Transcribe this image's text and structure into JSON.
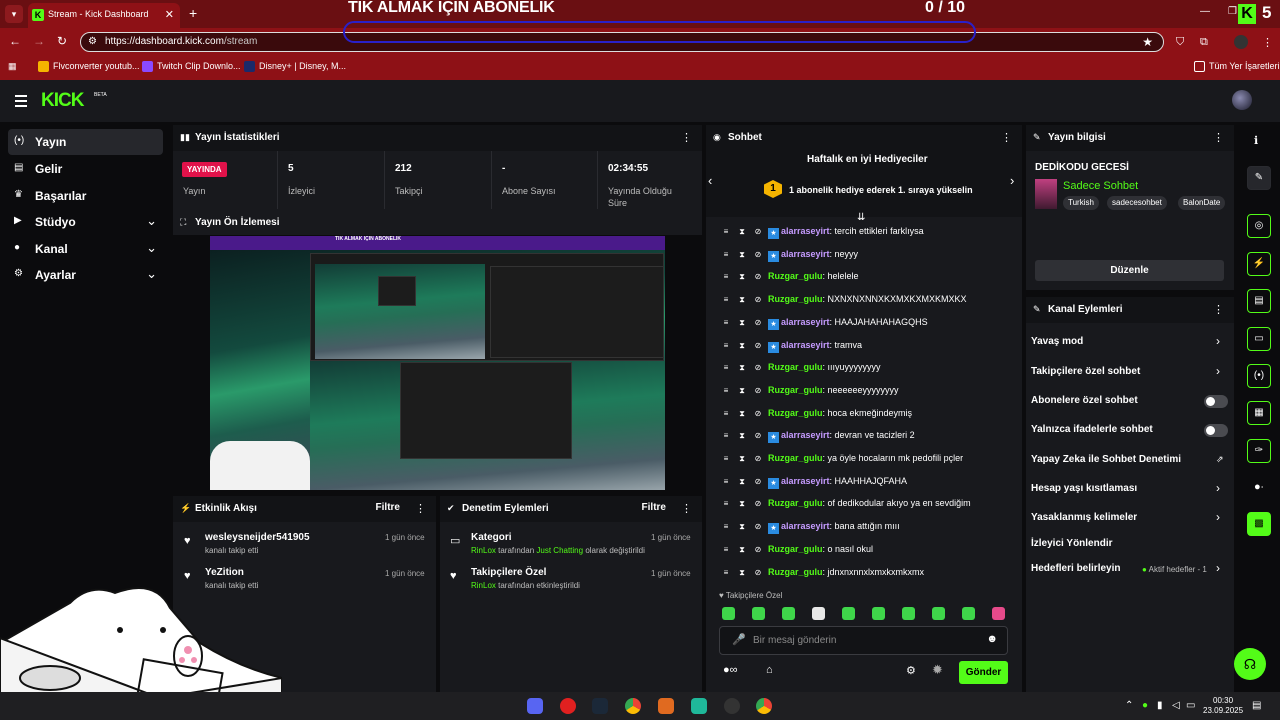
{
  "browser": {
    "tab_title": "Stream - Kick Dashboard",
    "tab_close": "✕",
    "new_tab": "+",
    "url_prefix": "https://",
    "url_host": "dashboard.kick.com",
    "url_path": "/stream",
    "bookmarks": [
      "Flvconverter youtub...",
      "Twitch Clip Downlo...",
      "Disney+ | Disney, M..."
    ],
    "all_bookmarks": "Tüm Yer İşaretleri"
  },
  "stream_overlay": {
    "title": "TIK ALMAK IÇIN ABONELIK",
    "count": "0  / 10",
    "corner_count": "5"
  },
  "app": {
    "logo": "KICK",
    "beta": "BETA"
  },
  "sidebar": {
    "items": [
      {
        "label": "Yayın",
        "icon": "broadcast-icon",
        "active": true
      },
      {
        "label": "Gelir",
        "icon": "wallet-icon"
      },
      {
        "label": "Başarılar",
        "icon": "trophy-icon"
      },
      {
        "label": "Stüdyo",
        "icon": "video-icon",
        "expandable": true
      },
      {
        "label": "Kanal",
        "icon": "user-icon",
        "expandable": true
      },
      {
        "label": "Ayarlar",
        "icon": "gear-icon",
        "expandable": true
      }
    ]
  },
  "stats": {
    "title": "Yayın İstatistikleri",
    "live_badge": "YAYINDA",
    "items": [
      {
        "value": "",
        "label": "Yayın"
      },
      {
        "value": "5",
        "label": "İzleyici"
      },
      {
        "value": "212",
        "label": "Takipçi"
      },
      {
        "value": "-",
        "label": "Abone Sayısı"
      },
      {
        "value": "02:34:55",
        "label": "Yayında Olduğu Süre"
      }
    ]
  },
  "preview": {
    "title": "Yayın Ön İzlemesi",
    "overlay_text": "TIK ALMAK IÇIN ABONELIK"
  },
  "activity": {
    "title": "Etkinlik Akışı",
    "filter": "Filtre",
    "items": [
      {
        "user": "wesleysneijder541905",
        "action": "kanalı takip etti",
        "time": "1 gün önce"
      },
      {
        "user": "YeZition",
        "action": "kanalı takip etti",
        "time": "1 gün önce"
      }
    ]
  },
  "moderation": {
    "title": "Denetim Eylemleri",
    "filter": "Filtre",
    "items": [
      {
        "title": "Kategori",
        "actor": "RinLox",
        "middle": " tarafından ",
        "target": "Just Chatting",
        "end": " olarak değiştirildi",
        "time": "1 gün önce"
      },
      {
        "title": "Takipçilere Özel",
        "actor": "RinLox",
        "middle": " tarafından etkinleştirildi",
        "target": "",
        "end": "",
        "time": "1 gün önce"
      }
    ]
  },
  "chat": {
    "title": "Sohbet",
    "gifters_title": "Haftalık en iyi Hediyeciler",
    "gifters_rank": "1",
    "gifters_text": "1 abonelik hediye ederek 1. sıraya yükselin",
    "followers_only": "Takipçilere Özel",
    "placeholder": "Bir mesaj gönderin",
    "send": "Gönder",
    "messages": [
      {
        "user": "alarraseyirt",
        "text": ": tercih ettikleri farklıysa",
        "badge": true
      },
      {
        "user": "alarraseyirt",
        "text": ": neyyy",
        "badge": true
      },
      {
        "user": "Ruzgar_gulu",
        "text": ": helelele",
        "badge": false
      },
      {
        "user": "Ruzgar_gulu",
        "text": ": NXNXNXNNXKXMXKXMXKMXKX",
        "badge": false
      },
      {
        "user": "alarraseyirt",
        "text": ": HAAJAHAHAHAGQHS",
        "badge": true
      },
      {
        "user": "alarraseyirt",
        "text": ": tramva",
        "badge": true
      },
      {
        "user": "Ruzgar_gulu",
        "text": ": ıııyuyyyyyyyy",
        "badge": false
      },
      {
        "user": "Ruzgar_gulu",
        "text": ": neeeeeeyyyyyyyy",
        "badge": false
      },
      {
        "user": "Ruzgar_gulu",
        "text": ": hoca ekmeğindeymiş",
        "badge": false
      },
      {
        "user": "alarraseyirt",
        "text": ": devran ve tacizleri 2",
        "badge": true
      },
      {
        "user": "Ruzgar_gulu",
        "text": ": ya öyle hocaların mk pedofili pçler",
        "badge": false
      },
      {
        "user": "alarraseyirt",
        "text": ": HAAHHAJQFAHA",
        "badge": true
      },
      {
        "user": "Ruzgar_gulu",
        "text": ": of dedikodular akıyo ya en sevdiğim",
        "badge": false
      },
      {
        "user": "alarraseyirt",
        "text": ": bana attığın mııı",
        "badge": true
      },
      {
        "user": "Ruzgar_gulu",
        "text": ": o nasıl okul",
        "badge": false
      },
      {
        "user": "Ruzgar_gulu",
        "text": ": jdnxnxnnxlxmxkxmkxmx",
        "badge": false
      }
    ]
  },
  "stream_info": {
    "title": "Yayın bilgisi",
    "stream_title": "DEDİKODU GECESİ",
    "mode": "Sadece Sohbet",
    "tags": [
      "Turkish",
      "sadecesohbet",
      "BalonDate"
    ],
    "edit": "Düzenle"
  },
  "channel_actions": {
    "title": "Kanal Eylemleri",
    "items": [
      {
        "label": "Yavaş mod",
        "control": "chevron"
      },
      {
        "label": "Takipçilere özel sohbet",
        "control": "chevron"
      },
      {
        "label": "Abonelere özel sohbet",
        "control": "toggle"
      },
      {
        "label": "Yalnızca ifadelerle sohbet",
        "control": "toggle"
      },
      {
        "label": "Yapay Zeka ile Sohbet Denetimi",
        "control": "external"
      },
      {
        "label": "Hesap yaşı kısıtlaması",
        "control": "chevron"
      },
      {
        "label": "Yasaklanmış kelimeler",
        "control": "chevron"
      },
      {
        "label": "İzleyici Yönlendir",
        "control": "none"
      },
      {
        "label": "Hedefleri belirleyin",
        "control": "chevron"
      }
    ],
    "goals_status": "Aktif hedefler - 1"
  },
  "taskbar": {
    "time": "00:30",
    "date": "23.09.2025"
  },
  "colors": {
    "accent": "#53fc18",
    "live": "#e1124a",
    "browser_frame": "#8e1116"
  }
}
